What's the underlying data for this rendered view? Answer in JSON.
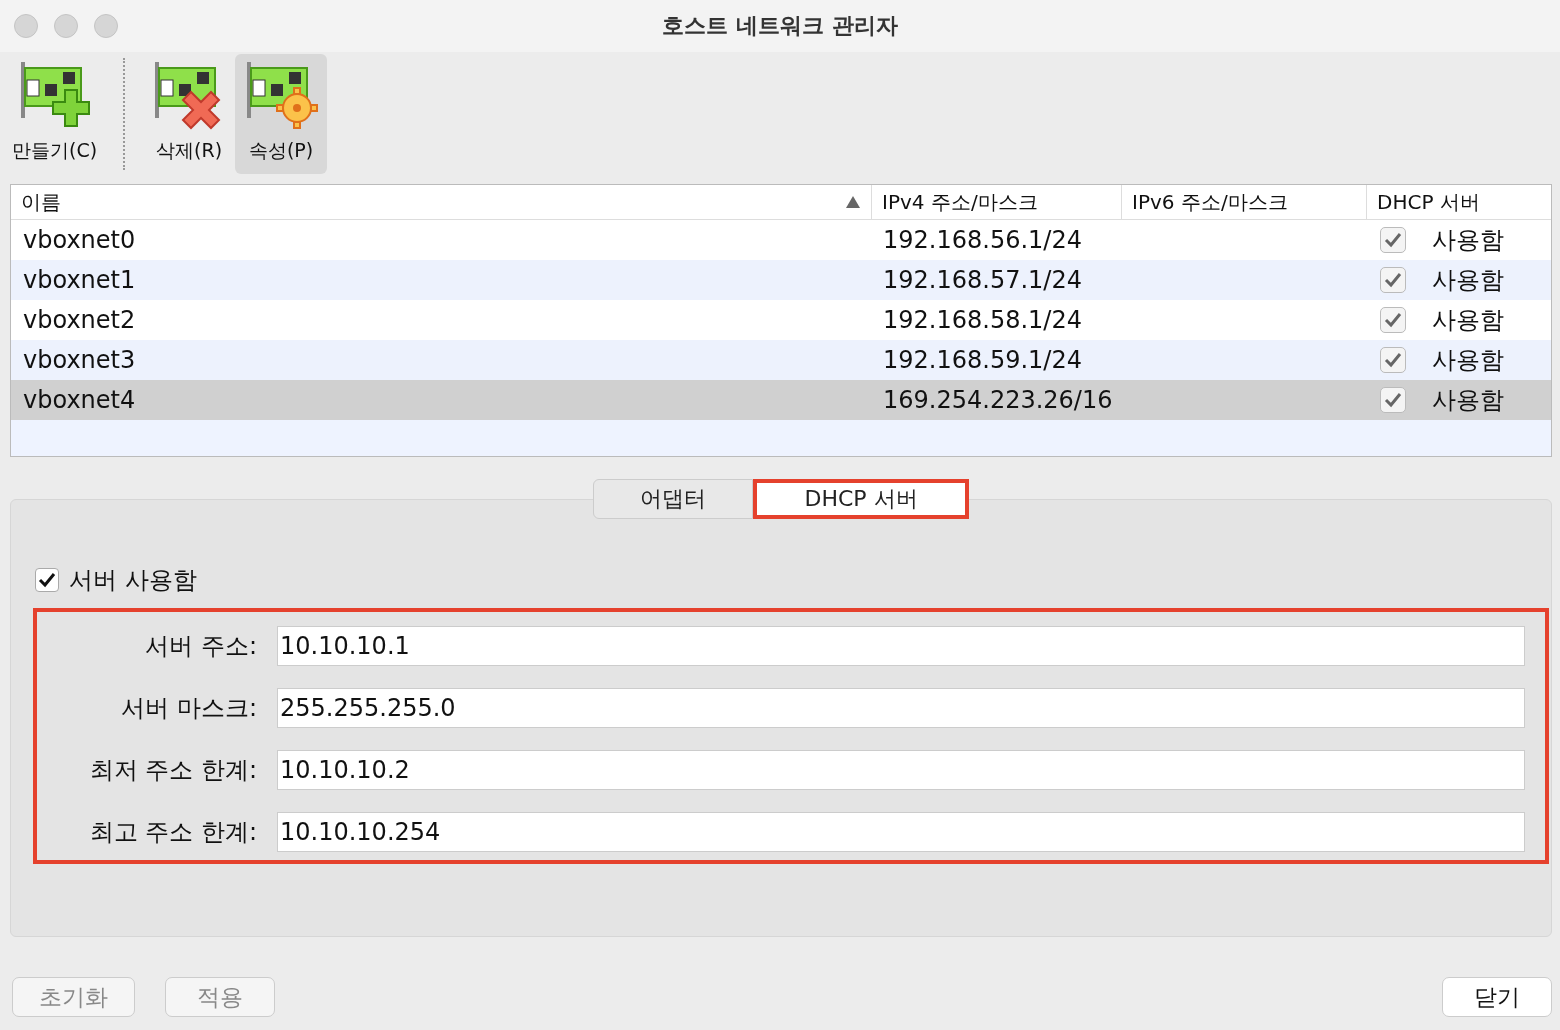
{
  "window": {
    "title": "호스트 네트워크 관리자"
  },
  "toolbar": [
    {
      "label": "만들기(C)",
      "kind": "create",
      "selected": false
    },
    {
      "label": "삭제(R)",
      "kind": "remove",
      "selected": false
    },
    {
      "label": "속성(P)",
      "kind": "properties",
      "selected": true
    }
  ],
  "table": {
    "columns": [
      {
        "label": "이름",
        "sorted": true
      },
      {
        "label": "IPv4 주소/마스크",
        "sorted": false
      },
      {
        "label": "IPv6 주소/마스크",
        "sorted": false
      },
      {
        "label": "DHCP 서버",
        "sorted": false
      }
    ],
    "rows": [
      {
        "name": "vboxnet0",
        "ipv4": "192.168.56.1/24",
        "dhcp_checked": true,
        "dhcp": "사용함",
        "selected": false
      },
      {
        "name": "vboxnet1",
        "ipv4": "192.168.57.1/24",
        "dhcp_checked": true,
        "dhcp": "사용함",
        "selected": false
      },
      {
        "name": "vboxnet2",
        "ipv4": "192.168.58.1/24",
        "dhcp_checked": true,
        "dhcp": "사용함",
        "selected": false
      },
      {
        "name": "vboxnet3",
        "ipv4": "192.168.59.1/24",
        "dhcp_checked": true,
        "dhcp": "사용함",
        "selected": false
      },
      {
        "name": "vboxnet4",
        "ipv4": "169.254.223.26/16",
        "dhcp_checked": true,
        "dhcp": "사용함",
        "selected": true
      }
    ]
  },
  "tabs": [
    {
      "label": "어댑터",
      "selected": false,
      "highlighted": false
    },
    {
      "label": "DHCP 서버",
      "selected": true,
      "highlighted": true
    }
  ],
  "server_enabled": {
    "label": "서버 사용함",
    "checked": true
  },
  "fields_highlighted": true,
  "fields": [
    {
      "label": "서버 주소:",
      "value": "10.10.10.1"
    },
    {
      "label": "서버 마스크:",
      "value": "255.255.255.0"
    },
    {
      "label": "최저 주소 한계:",
      "value": "10.10.10.2"
    },
    {
      "label": "최고 주소 한계:",
      "value": "10.10.10.254"
    }
  ],
  "buttons": [
    {
      "label": "초기화",
      "disabled": true,
      "kind": "left"
    },
    {
      "label": "적용",
      "disabled": true,
      "kind": "left"
    },
    {
      "label": "닫기",
      "disabled": false,
      "kind": "right"
    }
  ]
}
